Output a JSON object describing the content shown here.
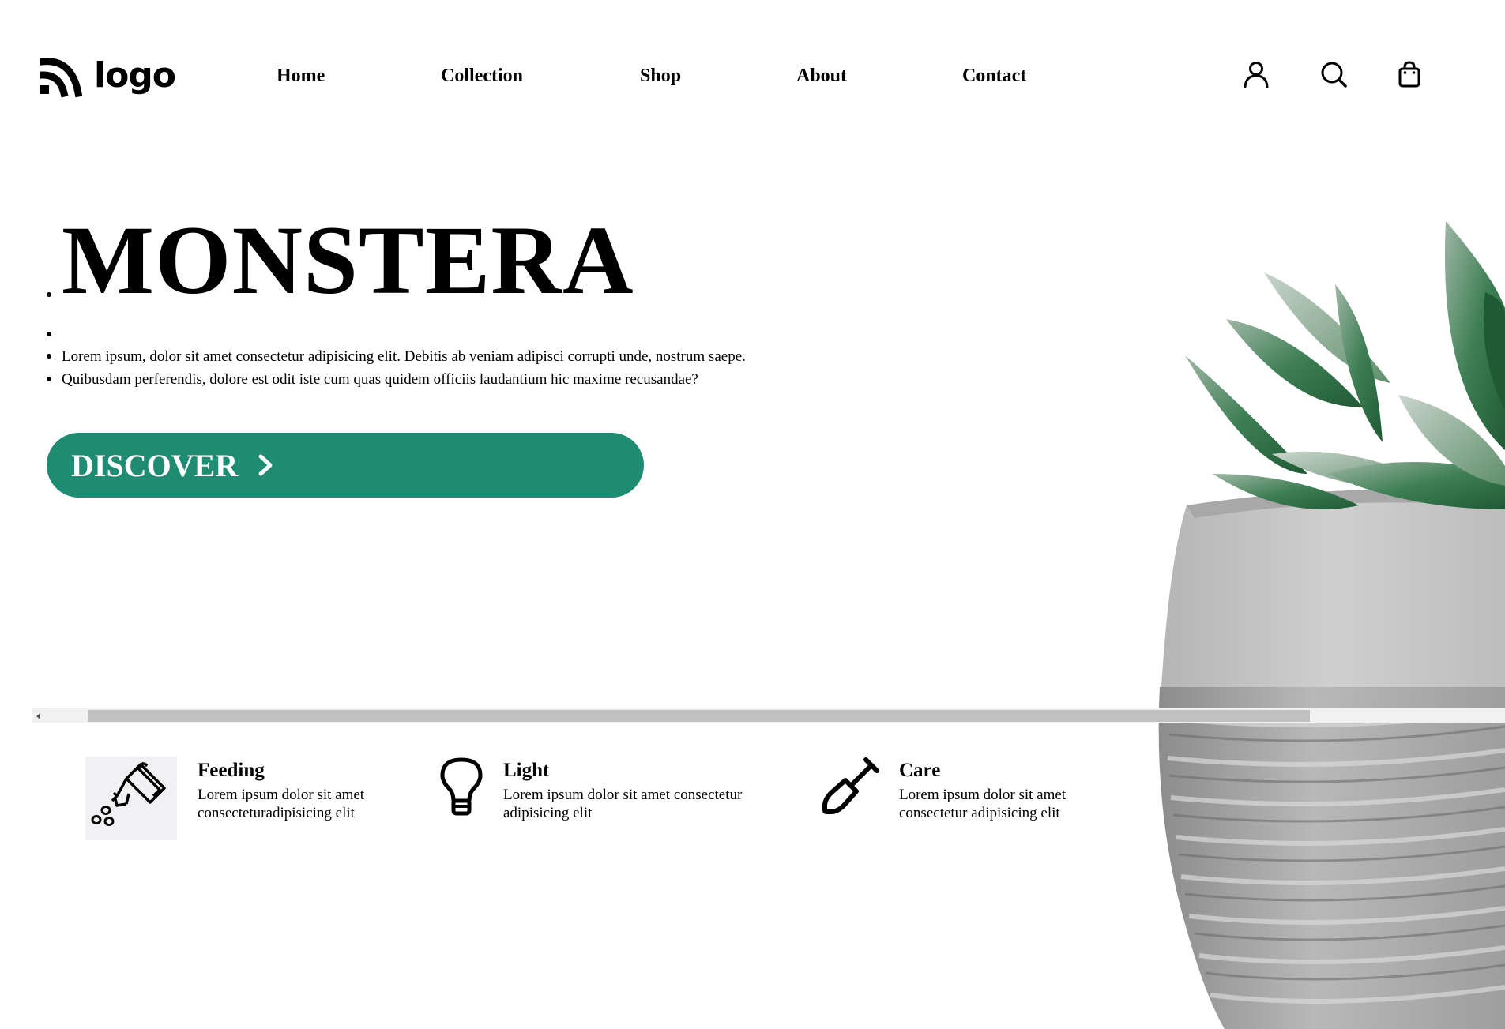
{
  "header": {
    "logo_text": "logo",
    "nav": [
      "Home",
      "Collection",
      "Shop",
      "About",
      "Contact"
    ],
    "icons": [
      "user-icon",
      "search-icon",
      "shopping-bag-icon"
    ]
  },
  "hero": {
    "title": "MONSTERA",
    "lines": [
      "Lorem ipsum, dolor sit amet consectetur adipisicing elit. Debitis ab veniam adipisci corrupti unde, nostrum saepe.",
      "Quibusdam perferendis, dolore est odit iste cum quas quidem officiis laudantium hic maxime recusandae?"
    ],
    "cta_label": "DISCOVER",
    "cta_color": "#1e8c73"
  },
  "features": [
    {
      "icon": "watering-can-icon",
      "title": "Feeding",
      "desc": "Lorem ipsum dolor sit amet consecteturadipisicing elit"
    },
    {
      "icon": "light-bulb-icon",
      "title": "Light",
      "desc": "Lorem ipsum dolor sit amet consectetur adipisicing elit"
    },
    {
      "icon": "shovel-icon",
      "title": "Care",
      "desc": "Lorem ipsum dolor sit amet consectetur adipisicing elit"
    }
  ],
  "colors": {
    "accent": "#1e8c73",
    "text": "#000000",
    "background": "#ffffff"
  }
}
